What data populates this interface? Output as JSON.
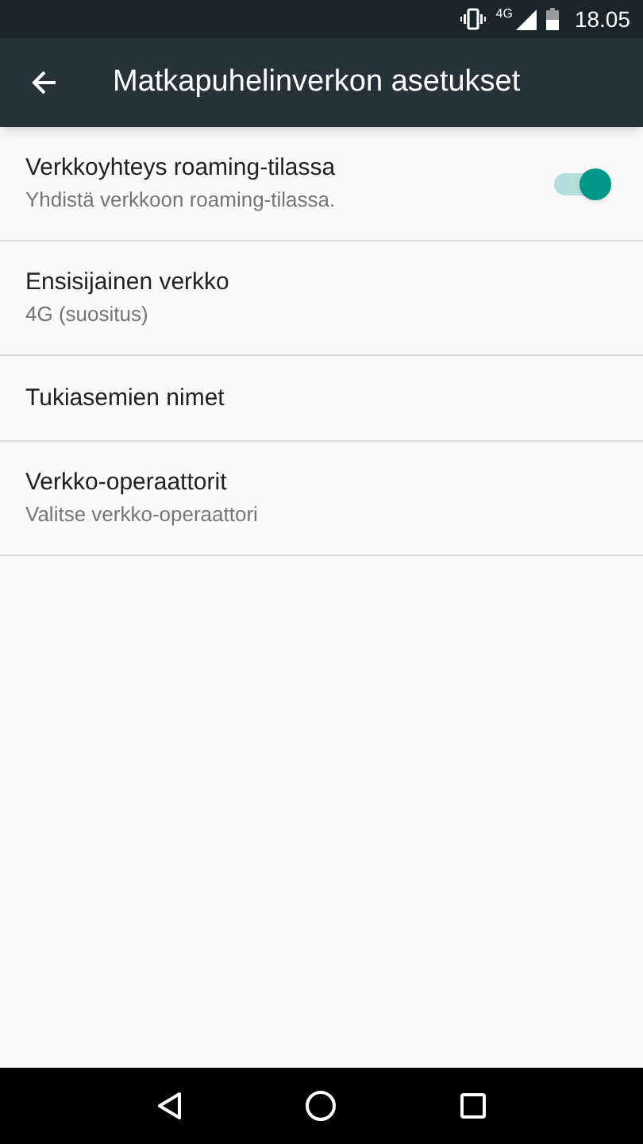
{
  "status_bar": {
    "network": "4G",
    "time": "18.05"
  },
  "app_bar": {
    "title": "Matkapuhelinverkon asetukset"
  },
  "settings": [
    {
      "kind": "switch",
      "title": "Verkkoyhteys roaming-tilassa",
      "summary": "Yhdistä verkkoon roaming-tilassa.",
      "on": true
    },
    {
      "kind": "plain",
      "title": "Ensisijainen verkko",
      "summary": "4G (suositus)"
    },
    {
      "kind": "plain",
      "title": "Tukiasemien nimet"
    },
    {
      "kind": "plain",
      "title": "Verkko-operaattorit",
      "summary": "Valitse verkko-operaattori"
    }
  ]
}
